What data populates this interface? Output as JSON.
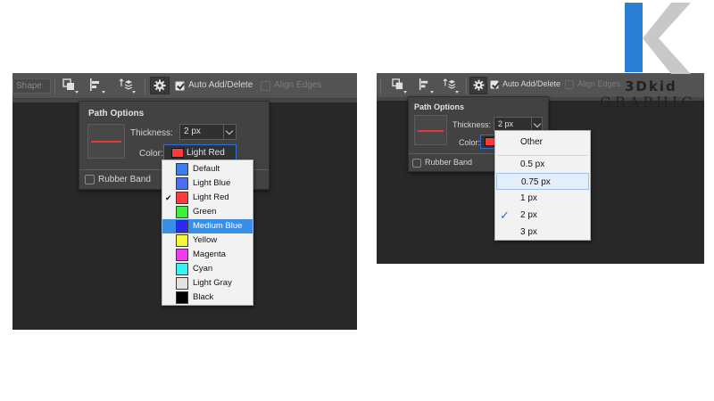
{
  "left": {
    "toolbar": {
      "shape_label": "Shape",
      "auto_add_delete": "Auto Add/Delete",
      "auto_add_delete_checked": true,
      "align_edges": "Align Edges",
      "align_edges_checked": false
    },
    "path_options": {
      "title": "Path Options",
      "thickness_label": "Thickness:",
      "thickness_value": "2 px",
      "color_label": "Color:",
      "color_value": "Light Red",
      "rubber_band": "Rubber Band",
      "rubber_band_checked": false
    },
    "color_menu": {
      "items": [
        {
          "label": "Default",
          "color": "#3a7ff0"
        },
        {
          "label": "Light Blue",
          "color": "#4d6cf5"
        },
        {
          "label": "Light Red",
          "color": "#ff3a3a",
          "checked": true
        },
        {
          "label": "Green",
          "color": "#3bf03b"
        },
        {
          "label": "Medium Blue",
          "color": "#2a2af2",
          "highlighted": true
        },
        {
          "label": "Yellow",
          "color": "#f6f63a"
        },
        {
          "label": "Magenta",
          "color": "#f23af2"
        },
        {
          "label": "Cyan",
          "color": "#3af2f2"
        },
        {
          "label": "Light Gray",
          "color": "#e2e2e2"
        },
        {
          "label": "Black",
          "color": "#000000"
        }
      ]
    }
  },
  "right": {
    "toolbar": {
      "auto_add_delete": "Auto Add/Delete",
      "auto_add_delete_checked": true,
      "align_edges": "Align Edges",
      "align_edges_checked": false
    },
    "path_options": {
      "title": "Path Options",
      "thickness_label": "Thickness:",
      "thickness_value": "2 px",
      "color_label": "Color:",
      "rubber_band": "Rubber Band",
      "rubber_band_checked": false
    },
    "thickness_menu": {
      "other": "Other",
      "items": [
        {
          "label": "0.5 px"
        },
        {
          "label": "0.75 px",
          "hovered": true
        },
        {
          "label": "1 px"
        },
        {
          "label": "2 px",
          "checked": true
        },
        {
          "label": "3 px"
        }
      ]
    }
  },
  "logo": {
    "letter": "K",
    "line1": "3Dkid",
    "line2": "GRAPHIC",
    "blue": "#2a7fd4",
    "gray": "#c8c8c8"
  },
  "colors": {
    "panel_bg": "#282828",
    "toolbar_bg": "#535353",
    "popup_bg": "#424242",
    "menu_highlight": "#3a8ee6",
    "accent_red": "#e13a3a"
  }
}
